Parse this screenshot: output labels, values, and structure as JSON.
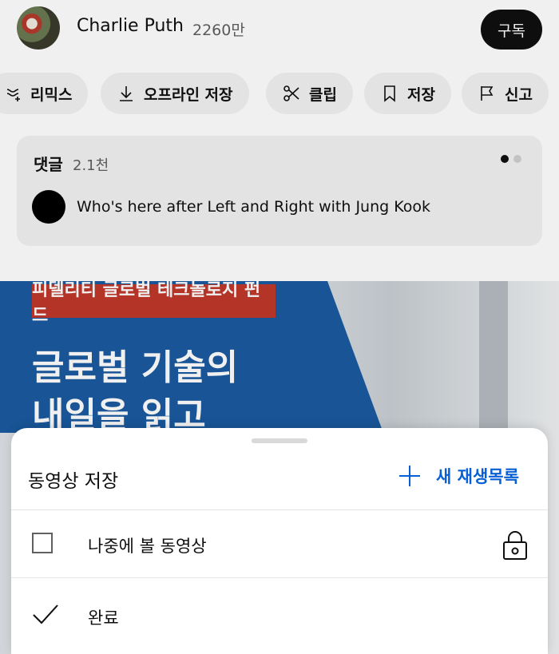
{
  "channel": {
    "name": "Charlie Puth",
    "subscribers": "2260만",
    "subscribe_label": "구독"
  },
  "actions": [
    {
      "label": "리믹스",
      "icon": "remix-icon"
    },
    {
      "label": "오프라인 저장",
      "icon": "download-icon"
    },
    {
      "label": "클립",
      "icon": "scissors-icon"
    },
    {
      "label": "저장",
      "icon": "bookmark-icon"
    },
    {
      "label": "신고",
      "icon": "flag-icon"
    }
  ],
  "comments": {
    "title": "댓글",
    "count": "2.1천",
    "top_comment": "Who's here after Left and Right with Jung Kook"
  },
  "ad": {
    "tag": "피델리티 글로벌 테크놀로지 펀드",
    "headline_line1": "글로벌 기술의",
    "headline_line2": "내일을 읽고"
  },
  "save_sheet": {
    "title": "동영상 저장",
    "new_playlist_label": "새 재생목록",
    "playlists": [
      {
        "label": "나중에 볼 동영상",
        "checked": false,
        "private": true
      },
      {
        "label": "완료",
        "checked": true,
        "private": false
      }
    ]
  },
  "colors": {
    "accent": "#065fd4",
    "ad_blue": "#1a5aa0",
    "ad_red": "#c0392b"
  }
}
